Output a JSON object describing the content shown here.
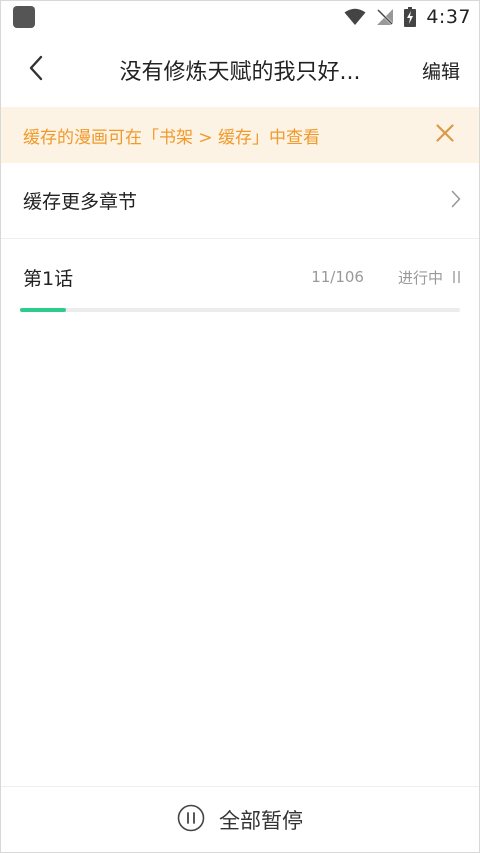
{
  "status_bar": {
    "time": "4:37",
    "icons": [
      "app-notification-icon",
      "wifi-icon",
      "no-signal-icon",
      "battery-charging-icon"
    ]
  },
  "header": {
    "back_icon": "chevron-left-icon",
    "title": "没有修炼天赋的我只好...",
    "edit_label": "编辑"
  },
  "notice": {
    "text": "缓存的漫画可在「书架 > 缓存」中查看",
    "close_icon": "close-icon",
    "color": "#f09a2c",
    "background": "#fdf3e4"
  },
  "more_row": {
    "label": "缓存更多章节",
    "icon": "chevron-right-icon"
  },
  "chapters": [
    {
      "name": "第1话",
      "count": "11/106",
      "status": "进行中",
      "progress": 0.104,
      "progress_color": "#2ecb8f",
      "action_icon": "pause-icon"
    }
  ],
  "bottom_bar": {
    "icon": "pause-circle-icon",
    "label": "全部暂停"
  }
}
